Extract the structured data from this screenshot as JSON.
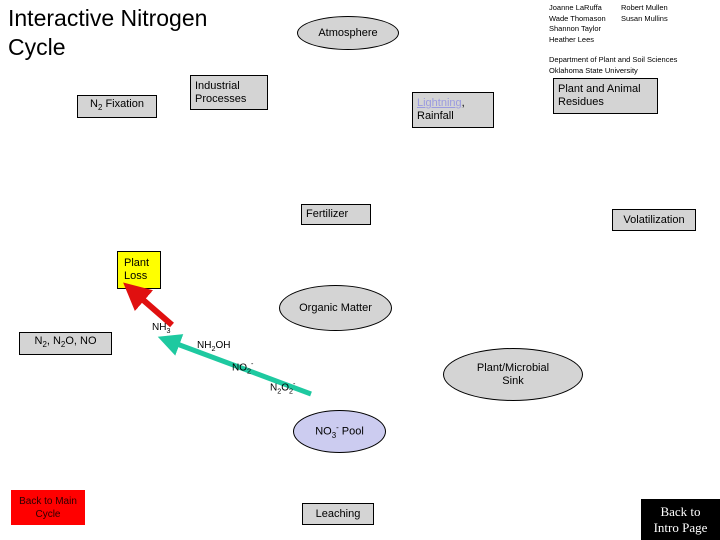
{
  "page": {
    "title_line1": "Interactive Nitrogen",
    "title_line2": "Cycle"
  },
  "credits": {
    "names": [
      "Joanne LaRuffa",
      "Robert Mullen",
      "Wade Thomason",
      "Susan Mullins",
      "Shannon Taylor",
      "",
      "Heather Lees",
      ""
    ],
    "department": "Department of Plant and Soil Sciences",
    "university": "Oklahoma State University"
  },
  "nodes": {
    "n2_fixation": "N2 Fixation",
    "industrial_processes_line1": "Industrial",
    "industrial_processes_line2": "Processes",
    "atmosphere": "Atmosphere",
    "lightning_link": "Lightning",
    "lightning_comma": ",",
    "rainfall": "Rainfall",
    "plant_animal_residues_line1": "Plant and Animal",
    "plant_animal_residues_line2": "Residues",
    "fertilizer": "Fertilizer",
    "volatilization": "Volatilization",
    "plant_loss_line1": "Plant",
    "plant_loss_line2": "Loss",
    "organic_matter": "Organic Matter",
    "gases": "N2, N2O, NO",
    "plant_microbial_sink_line1": "Plant/Microbial",
    "plant_microbial_sink_line2": "Sink",
    "no3_pool": "NO3- Pool",
    "leaching": "Leaching"
  },
  "arrow_labels": {
    "nh3": "NH3",
    "nh2oh": "NH2OH",
    "no2": "NO2-",
    "n2o2": "N2O2-"
  },
  "buttons": {
    "back_to_main_line1": "Back to Main",
    "back_to_main_line2": "Cycle",
    "back_to_intro_line1": "Back to",
    "back_to_intro_line2": "Intro Page"
  },
  "colors": {
    "node_fill": "#d4d4d4",
    "ellipse_lavender": "#ccccf0",
    "yellow": "#ffff00",
    "red_arrow": "#e01010",
    "teal_arrow": "#1ec9a0",
    "link": "#9a9ae0",
    "red_button": "#ff0000",
    "black_button": "#000000"
  }
}
